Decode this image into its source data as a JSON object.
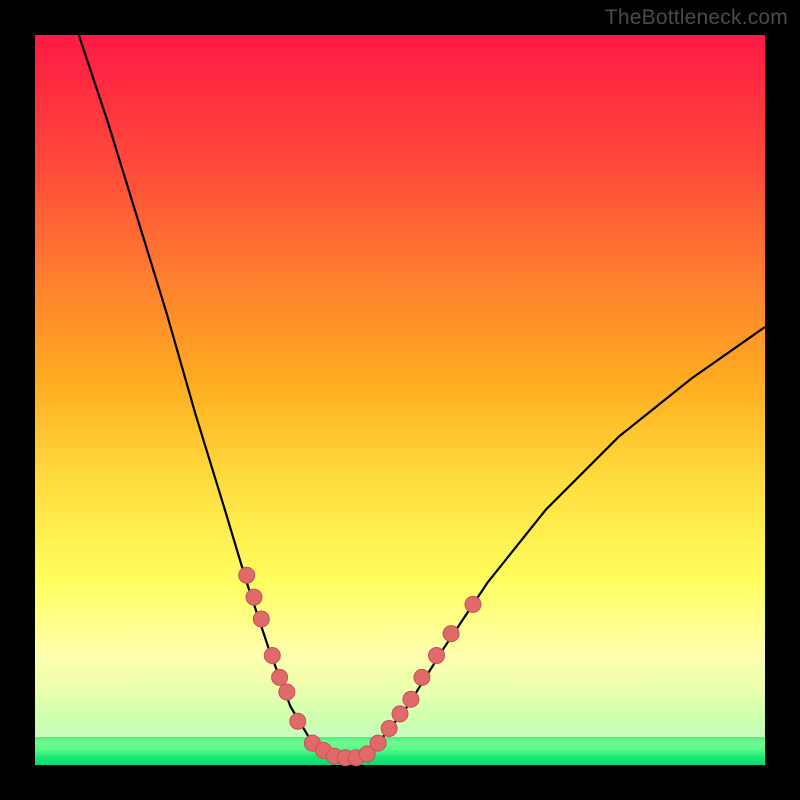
{
  "watermark": "TheBottleneck.com",
  "colors": {
    "background": "#000000",
    "gradient_top": "#ff1a44",
    "gradient_bottom": "#00dd75",
    "curve_stroke": "#000000",
    "marker_fill": "#e06a6a",
    "marker_stroke": "#c94f55"
  },
  "chart_data": {
    "type": "line",
    "title": "",
    "xlabel": "",
    "ylabel": "",
    "xlim": [
      0,
      100
    ],
    "ylim": [
      0,
      100
    ],
    "curve": [
      {
        "x": 6,
        "y": 100
      },
      {
        "x": 10,
        "y": 88
      },
      {
        "x": 14,
        "y": 75
      },
      {
        "x": 18,
        "y": 62
      },
      {
        "x": 22,
        "y": 48
      },
      {
        "x": 26,
        "y": 35
      },
      {
        "x": 29,
        "y": 25
      },
      {
        "x": 32,
        "y": 16
      },
      {
        "x": 35,
        "y": 8
      },
      {
        "x": 38,
        "y": 3
      },
      {
        "x": 41,
        "y": 1
      },
      {
        "x": 44,
        "y": 1
      },
      {
        "x": 47,
        "y": 3
      },
      {
        "x": 51,
        "y": 8
      },
      {
        "x": 56,
        "y": 16
      },
      {
        "x": 62,
        "y": 25
      },
      {
        "x": 70,
        "y": 35
      },
      {
        "x": 80,
        "y": 45
      },
      {
        "x": 90,
        "y": 53
      },
      {
        "x": 100,
        "y": 60
      }
    ],
    "markers": [
      {
        "x": 29,
        "y": 26
      },
      {
        "x": 30,
        "y": 23
      },
      {
        "x": 31,
        "y": 20
      },
      {
        "x": 32.5,
        "y": 15
      },
      {
        "x": 33.5,
        "y": 12
      },
      {
        "x": 34.5,
        "y": 10
      },
      {
        "x": 36,
        "y": 6
      },
      {
        "x": 38,
        "y": 3
      },
      {
        "x": 39.5,
        "y": 2
      },
      {
        "x": 41,
        "y": 1.2
      },
      {
        "x": 42.5,
        "y": 1
      },
      {
        "x": 44,
        "y": 1
      },
      {
        "x": 45.5,
        "y": 1.5
      },
      {
        "x": 47,
        "y": 3
      },
      {
        "x": 48.5,
        "y": 5
      },
      {
        "x": 50,
        "y": 7
      },
      {
        "x": 51.5,
        "y": 9
      },
      {
        "x": 53,
        "y": 12
      },
      {
        "x": 55,
        "y": 15
      },
      {
        "x": 57,
        "y": 18
      },
      {
        "x": 60,
        "y": 22
      }
    ]
  }
}
